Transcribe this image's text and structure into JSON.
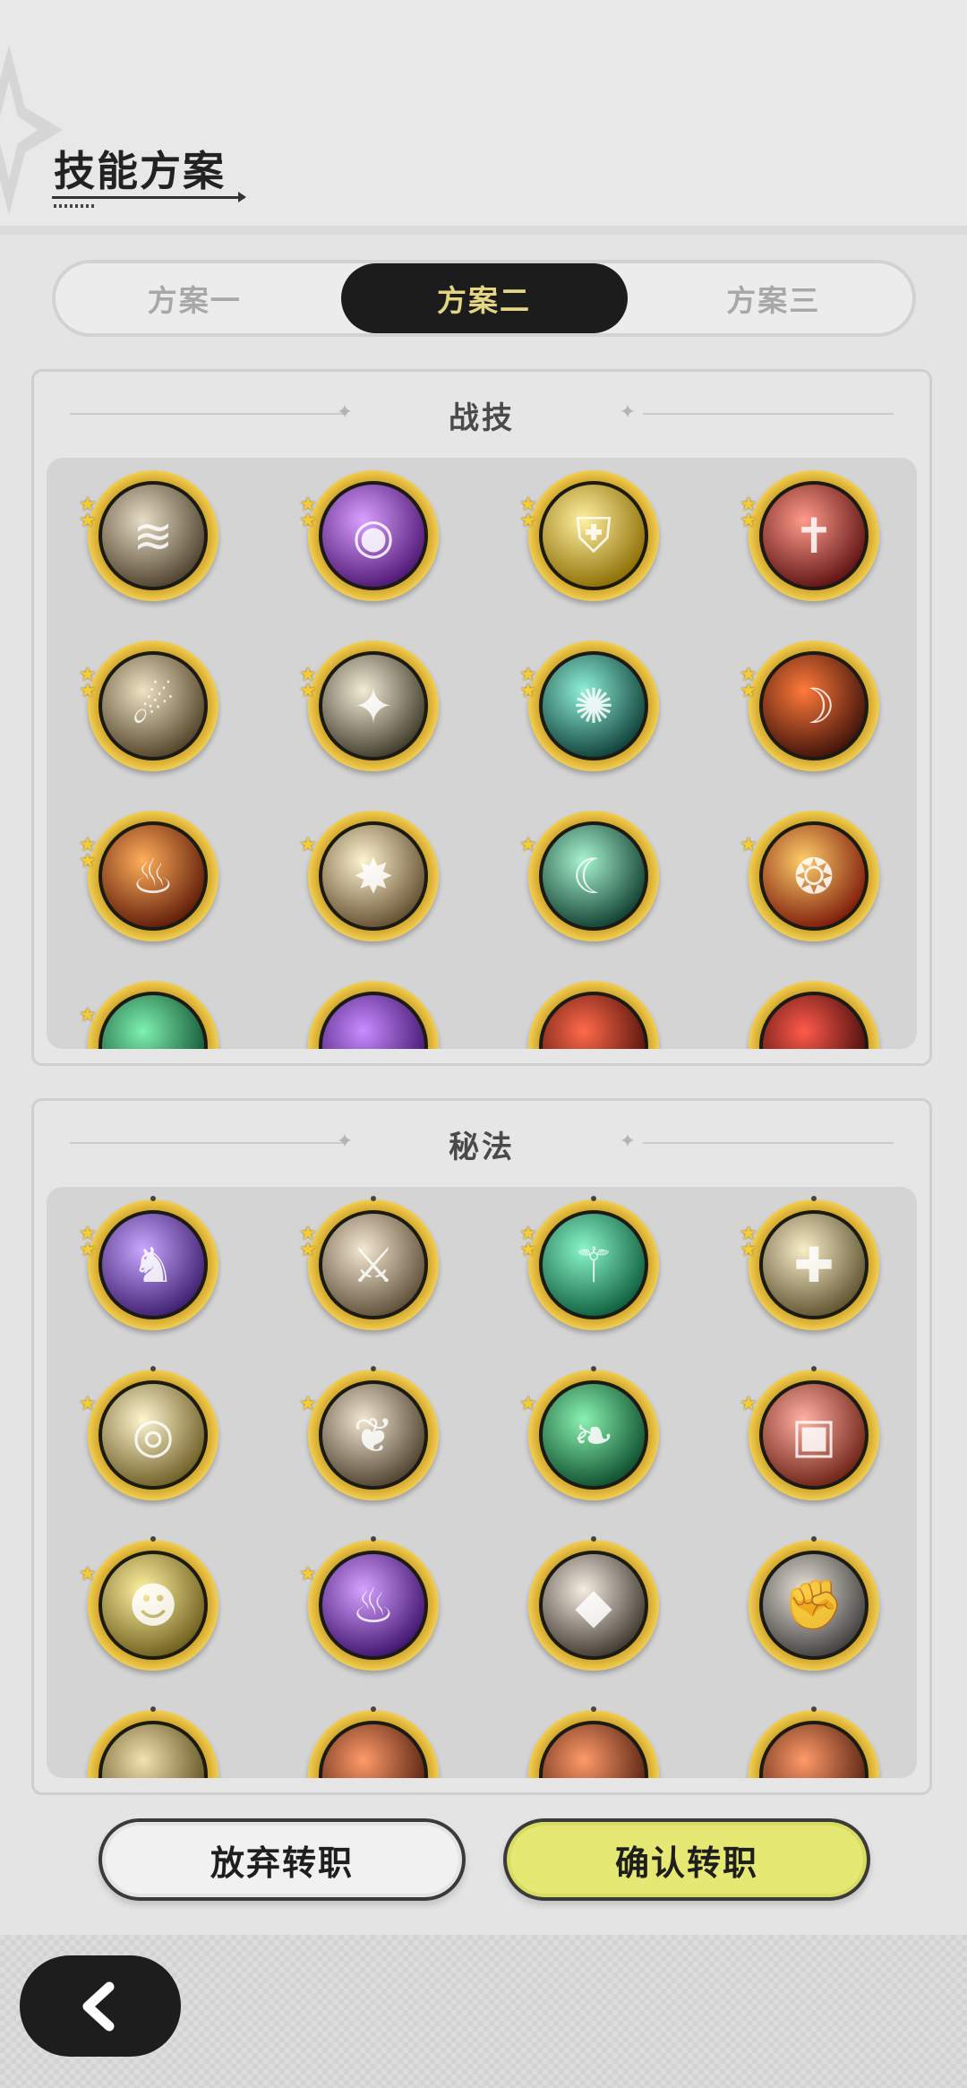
{
  "header": {
    "title": "技能方案"
  },
  "tabs": [
    {
      "label": "方案一",
      "active": false
    },
    {
      "label": "方案二",
      "active": true
    },
    {
      "label": "方案三",
      "active": false
    }
  ],
  "sections": {
    "combat": {
      "title": "战技",
      "icons": [
        {
          "name": "wind-slash-icon",
          "stars": 2,
          "colors": [
            "#e7dcc4",
            "#4a3e2a"
          ],
          "glyph": "≋"
        },
        {
          "name": "purple-orb-icon",
          "stars": 2,
          "colors": [
            "#d9a0ff",
            "#4a136e"
          ],
          "glyph": "◉"
        },
        {
          "name": "golden-shield-icon",
          "stars": 2,
          "colors": [
            "#fff0a0",
            "#8a6a00"
          ],
          "glyph": "⛨"
        },
        {
          "name": "red-sword-raise-icon",
          "stars": 2,
          "colors": [
            "#ff9a8a",
            "#5a0f0f"
          ],
          "glyph": "✝"
        },
        {
          "name": "wooden-strike-icon",
          "stars": 2,
          "colors": [
            "#efe2c2",
            "#4d3f25"
          ],
          "glyph": "☄"
        },
        {
          "name": "shadow-figure-icon",
          "stars": 2,
          "colors": [
            "#f2ecd6",
            "#3c3626"
          ],
          "glyph": "✦"
        },
        {
          "name": "green-web-icon",
          "stars": 2,
          "colors": [
            "#8ff0d6",
            "#0b3b34"
          ],
          "glyph": "✺"
        },
        {
          "name": "fire-arc-icon",
          "stars": 2,
          "colors": [
            "#ff7a3a",
            "#3a0f08"
          ],
          "glyph": "☽"
        },
        {
          "name": "flame-burst-icon",
          "stars": 2,
          "colors": [
            "#ffae5a",
            "#5a1706"
          ],
          "glyph": "♨"
        },
        {
          "name": "explosion-icon",
          "stars": 1,
          "colors": [
            "#fff4d0",
            "#5e4a2a"
          ],
          "glyph": "✸"
        },
        {
          "name": "teal-crescent-icon",
          "stars": 1,
          "colors": [
            "#a8f5d0",
            "#0c3a2c"
          ],
          "glyph": "☾"
        },
        {
          "name": "fire-spiral-icon",
          "stars": 1,
          "colors": [
            "#ffce6a",
            "#7a1506"
          ],
          "glyph": "❂"
        },
        {
          "name": "green-swirl-icon",
          "stars": 1,
          "colors": [
            "#7ff0b0",
            "#0b4b2a"
          ],
          "glyph": ""
        },
        {
          "name": "purple-spark-icon",
          "stars": 0,
          "colors": [
            "#c88cff",
            "#3b0f68"
          ],
          "glyph": ""
        },
        {
          "name": "red-claw-icon",
          "stars": 0,
          "colors": [
            "#ff6a4a",
            "#4a0c06"
          ],
          "glyph": ""
        },
        {
          "name": "crimson-slash-icon",
          "stars": 0,
          "colors": [
            "#ff5a4a",
            "#3a0808"
          ],
          "glyph": ""
        }
      ]
    },
    "arcane": {
      "title": "秘法",
      "icons": [
        {
          "name": "purple-beast-icon",
          "stars": 2,
          "colors": [
            "#c8a8ff",
            "#3a1a6a"
          ],
          "glyph": "♞"
        },
        {
          "name": "sword-buff-icon",
          "stars": 2,
          "colors": [
            "#f4e8d2",
            "#5a4a32"
          ],
          "glyph": "⚔"
        },
        {
          "name": "green-blade-icon",
          "stars": 2,
          "colors": [
            "#8af5c8",
            "#0a5a3a"
          ],
          "glyph": "⚚"
        },
        {
          "name": "heal-figure-icon",
          "stars": 2,
          "colors": [
            "#f8eec8",
            "#5a4f2a"
          ],
          "glyph": "✚"
        },
        {
          "name": "all-seeing-eye-icon",
          "stars": 1,
          "colors": [
            "#fff6d0",
            "#6a5a20"
          ],
          "glyph": "◎"
        },
        {
          "name": "maple-leaf-icon",
          "stars": 1,
          "colors": [
            "#f1e6d2",
            "#4a3e2a"
          ],
          "glyph": "❦"
        },
        {
          "name": "green-leaf-icon",
          "stars": 1,
          "colors": [
            "#8af2b0",
            "#0a4a2a"
          ],
          "glyph": "❧"
        },
        {
          "name": "red-scroll-icon",
          "stars": 1,
          "colors": [
            "#ffb2a2",
            "#6a1e12"
          ],
          "glyph": "▣"
        },
        {
          "name": "golden-spirit-icon",
          "stars": 1,
          "colors": [
            "#fff2a0",
            "#6a5a1a"
          ],
          "glyph": "☻"
        },
        {
          "name": "purple-flame-icon",
          "stars": 1,
          "colors": [
            "#d6a2ff",
            "#3a0f6a"
          ],
          "glyph": "♨"
        },
        {
          "name": "stone-shard-icon",
          "stars": 0,
          "colors": [
            "#f6ede2",
            "#3a332a"
          ],
          "glyph": "◆"
        },
        {
          "name": "fist-shield-icon",
          "stars": 0,
          "colors": [
            "#e8e2d6",
            "#3a3a3a"
          ],
          "glyph": "✊"
        },
        {
          "name": "arcane-icon-13",
          "stars": 0,
          "colors": [
            "#f2e2b0",
            "#5a4a1a"
          ],
          "glyph": ""
        },
        {
          "name": "arcane-icon-14",
          "stars": 0,
          "colors": [
            "#ff9a6a",
            "#4a1a0a"
          ],
          "glyph": ""
        },
        {
          "name": "arcane-icon-15",
          "stars": 0,
          "colors": [
            "#ff9a6a",
            "#4a1a0a"
          ],
          "glyph": ""
        },
        {
          "name": "arcane-icon-16",
          "stars": 0,
          "colors": [
            "#ff9a6a",
            "#4a1a0a"
          ],
          "glyph": ""
        }
      ]
    }
  },
  "buttons": {
    "abandon": "放弃转职",
    "confirm": "确认转职"
  },
  "nav": {
    "back_icon": "chevron-left-icon"
  }
}
